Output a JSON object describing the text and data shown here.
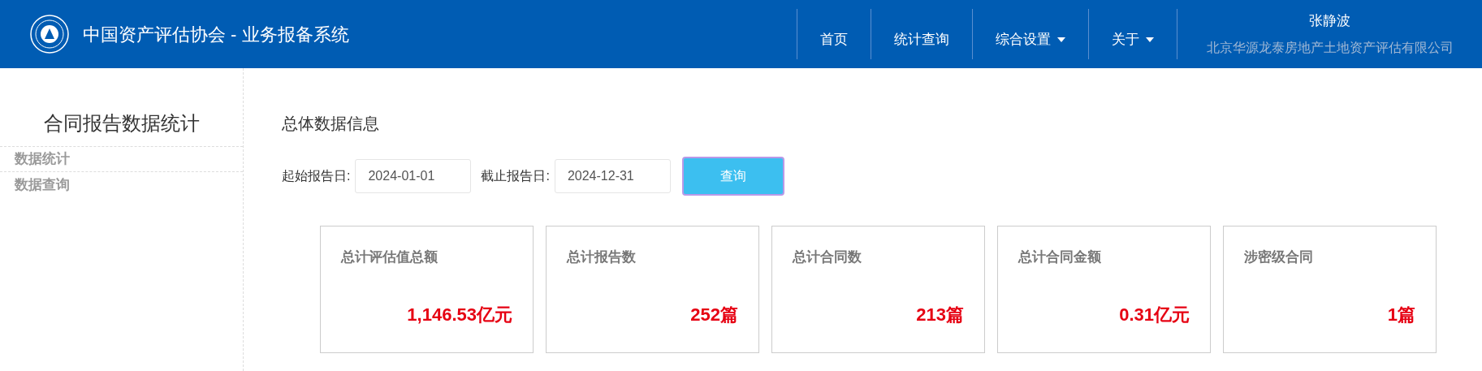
{
  "header": {
    "title": "中国资产评估协会 - 业务报备系统",
    "nav": [
      {
        "label": "首页",
        "dropdown": false
      },
      {
        "label": "统计查询",
        "dropdown": false
      },
      {
        "label": "综合设置",
        "dropdown": true
      },
      {
        "label": "关于",
        "dropdown": true
      }
    ],
    "user": {
      "name": "张静波",
      "company": "北京华源龙泰房地产土地资产评估有限公司"
    }
  },
  "sidebar": {
    "title": "合同报告数据统计",
    "items": [
      {
        "label": "数据统计"
      },
      {
        "label": "数据查询"
      }
    ]
  },
  "main": {
    "title": "总体数据信息",
    "filters": [
      {
        "label": "起始报告日:",
        "value": "2024-01-01"
      },
      {
        "label": "截止报告日:",
        "value": "2024-12-31"
      }
    ],
    "query_button": "查询",
    "cards": [
      {
        "label": "总计评估值总额",
        "value": "1,146.53亿元"
      },
      {
        "label": "总计报告数",
        "value": "252篇"
      },
      {
        "label": "总计合同数",
        "value": "213篇"
      },
      {
        "label": "总计合同金额",
        "value": "0.31亿元"
      },
      {
        "label": "涉密级合同",
        "value": "1篇"
      }
    ]
  }
}
